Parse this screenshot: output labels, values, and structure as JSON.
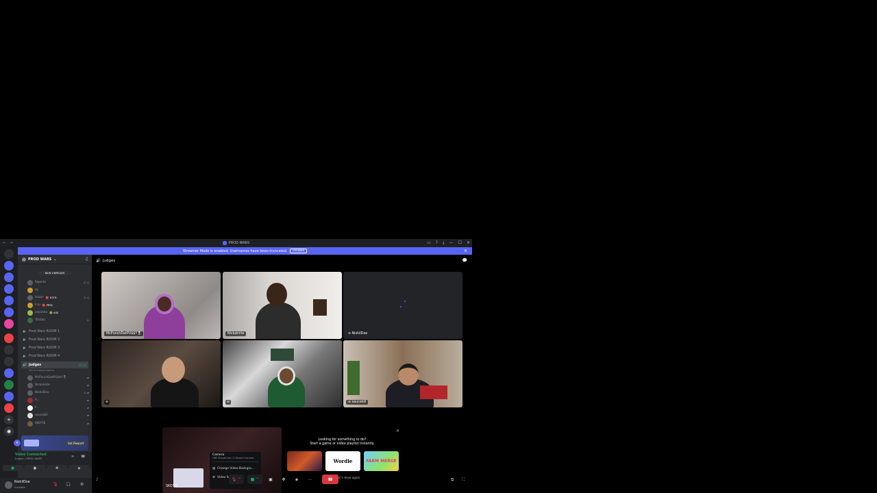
{
  "window": {
    "title": "PROD WARS",
    "nav_back": "←",
    "nav_fwd": "→",
    "controls": [
      "▭",
      "?",
      "⤓",
      "—",
      "☐",
      "✕"
    ]
  },
  "notice": {
    "text": "Streamer Mode is enabled. Usernames have been truncated.",
    "button": "Disable",
    "close": "✕"
  },
  "sidebar": {
    "guild_name": "PROD WARS",
    "chevron": "⌄",
    "new_unreads": "NEW UNREADS",
    "members_top": [
      {
        "name": "Skjentn",
        "tag": ""
      },
      {
        "name": "zy",
        "tag": ""
      },
      {
        "name": "Isaacr",
        "tag": "🔴 ESTR"
      },
      {
        "name": "li.lu",
        "tag": "🔴 PRTA"
      },
      {
        "name": "Iseralvlo",
        "tag": "🟢 ASE"
      },
      {
        "name": "Tolstao",
        "tag": ""
      }
    ],
    "channels": [
      {
        "name": "Prod Wars ROOM 1"
      },
      {
        "name": "Prod Wars ROOM 2"
      },
      {
        "name": "Prod Wars ROOM 3"
      },
      {
        "name": "Prod Wars ROOM 4"
      }
    ],
    "active_channel": {
      "name": "Judges",
      "time": "25:32",
      "status": "Set a channel status"
    },
    "voice_members": [
      {
        "name": "McPunchDatPU$$Y🎖"
      },
      {
        "name": "Nickatnite"
      },
      {
        "name": "NishilDoe"
      },
      {
        "name": "A..."
      },
      {
        "name": "F..."
      },
      {
        "name": "saucekill"
      },
      {
        "name": "SKOTIE"
      }
    ],
    "promo": {
      "button": "Get Reward"
    },
    "voice_panel": {
      "status": "Video Connected",
      "location": "Judges / PROD WARS"
    },
    "user": {
      "name": "NishilDoe",
      "status": "Invisible"
    }
  },
  "main": {
    "channel_title": "Judges",
    "tiles": [
      {
        "name": "McPunchDatPU$$Y🎖"
      },
      {
        "name": "Nickatnite"
      },
      {
        "name": "NishilDoe"
      },
      {
        "name": ""
      },
      {
        "name": ""
      },
      {
        "name": "saucekill"
      }
    ],
    "self_preview_name": "SKOTIE",
    "camera_menu": {
      "title": "Camera",
      "device": "OBS VirtualCam / 2 Stream Camera",
      "items": [
        "Change Video Backgro...",
        "Video Settings"
      ]
    },
    "activity": {
      "line1": "Looking for something to do?",
      "line2": "Start a game or video playlist instantly.",
      "games": [
        "",
        "Wordle",
        "FARM MERGE"
      ],
      "dont_show": "Don't show again"
    }
  },
  "colors": {
    "brand": "#5865f2",
    "green": "#23a55a",
    "red": "#da373c"
  }
}
